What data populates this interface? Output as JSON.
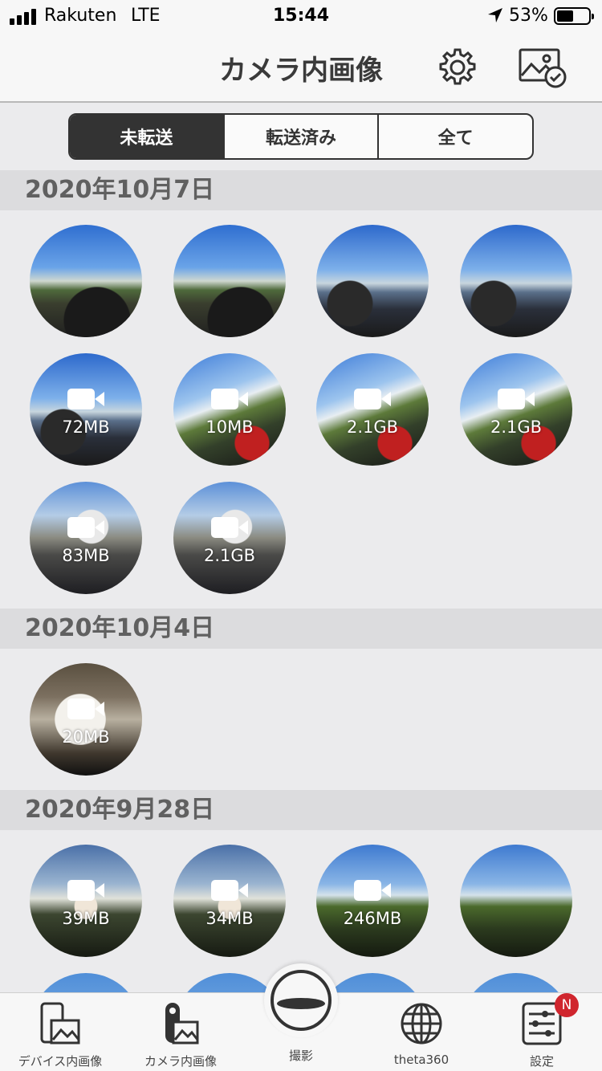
{
  "status_bar": {
    "carrier": "Rakuten",
    "network": "LTE",
    "time": "15:44",
    "battery": "53%",
    "battery_level": 0.53
  },
  "header": {
    "title": "カメラ内画像",
    "settings_icon": "gear-icon",
    "album_icon": "album-check-icon"
  },
  "segments": [
    {
      "label": "未転送",
      "active": true
    },
    {
      "label": "転送済み",
      "active": false
    },
    {
      "label": "全て",
      "active": false
    }
  ],
  "groups": [
    {
      "date": "2020年10月7日",
      "items": [
        {
          "type": "photo",
          "size": ""
        },
        {
          "type": "photo",
          "size": ""
        },
        {
          "type": "photo",
          "size": ""
        },
        {
          "type": "photo",
          "size": ""
        },
        {
          "type": "video",
          "size": "72MB"
        },
        {
          "type": "video",
          "size": "10MB"
        },
        {
          "type": "video",
          "size": "2.1GB"
        },
        {
          "type": "video",
          "size": "2.1GB"
        },
        {
          "type": "video",
          "size": "83MB"
        },
        {
          "type": "video",
          "size": "2.1GB"
        }
      ]
    },
    {
      "date": "2020年10月4日",
      "items": [
        {
          "type": "video",
          "size": "20MB"
        }
      ]
    },
    {
      "date": "2020年9月28日",
      "items": [
        {
          "type": "video",
          "size": "39MB"
        },
        {
          "type": "video",
          "size": "34MB"
        },
        {
          "type": "video",
          "size": "246MB"
        },
        {
          "type": "photo",
          "size": ""
        }
      ]
    }
  ],
  "tabbar": {
    "items": [
      {
        "label": "デバイス内画像",
        "icon": "phone-image-icon"
      },
      {
        "label": "カメラ内画像",
        "icon": "camera-image-icon"
      },
      {
        "label": "撮影",
        "icon": "shutter-icon"
      },
      {
        "label": "theta360",
        "icon": "globe-icon"
      },
      {
        "label": "設定",
        "icon": "settings-sliders-icon"
      }
    ],
    "badge": "N"
  }
}
